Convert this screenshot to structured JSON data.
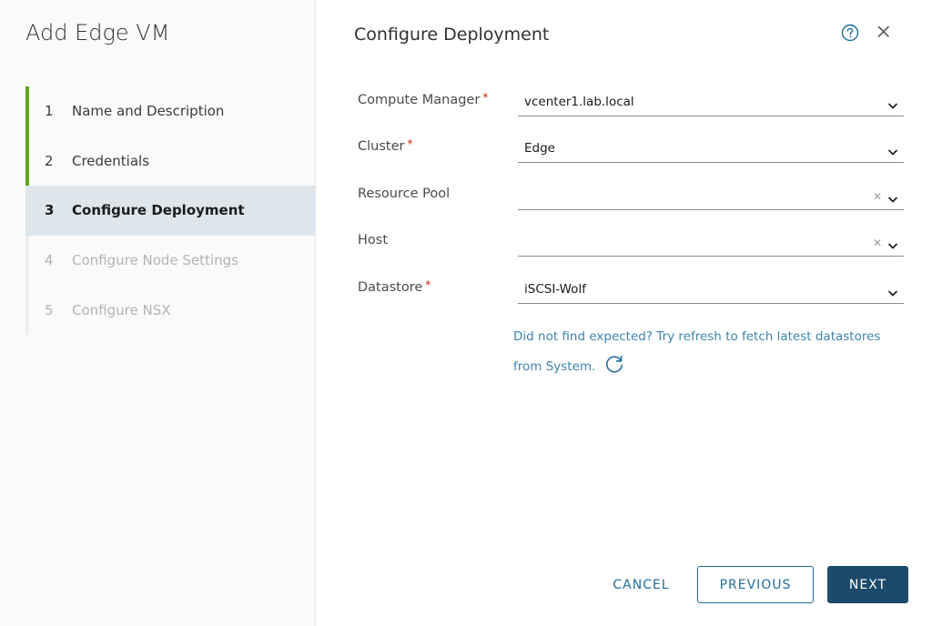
{
  "wizard": {
    "title": "Add Edge VM",
    "steps": [
      {
        "num": "1",
        "label": "Name and Description",
        "state": "done"
      },
      {
        "num": "2",
        "label": "Credentials",
        "state": "done"
      },
      {
        "num": "3",
        "label": "Configure Deployment",
        "state": "active"
      },
      {
        "num": "4",
        "label": "Configure Node Settings",
        "state": "disabled"
      },
      {
        "num": "5",
        "label": "Configure NSX",
        "state": "disabled"
      }
    ]
  },
  "header": {
    "title": "Configure Deployment",
    "help_icon": "help-circle-icon",
    "close_icon": "close-icon"
  },
  "form": {
    "compute_manager": {
      "label": "Compute Manager",
      "required": "*",
      "value": "vcenter1.lab.local"
    },
    "cluster": {
      "label": "Cluster",
      "required": "*",
      "value": "Edge"
    },
    "resource_pool": {
      "label": "Resource Pool",
      "value": "",
      "clear": "✕"
    },
    "host": {
      "label": "Host",
      "value": "",
      "clear": "✕"
    },
    "datastore": {
      "label": "Datastore",
      "required": "*",
      "value": "iSCSI-Wolf"
    },
    "hint": "Did not find expected? Try refresh to fetch latest datastores from System."
  },
  "footer": {
    "cancel_label": "CANCEL",
    "previous_label": "PREVIOUS",
    "next_label": "NEXT"
  },
  "colors": {
    "accent": "#1f6d9c",
    "primary_button": "#1b4a6b",
    "step_done": "#62a420",
    "active_step_bg": "#dee5eb",
    "required": "#c92100",
    "link": "#3f84ad"
  }
}
